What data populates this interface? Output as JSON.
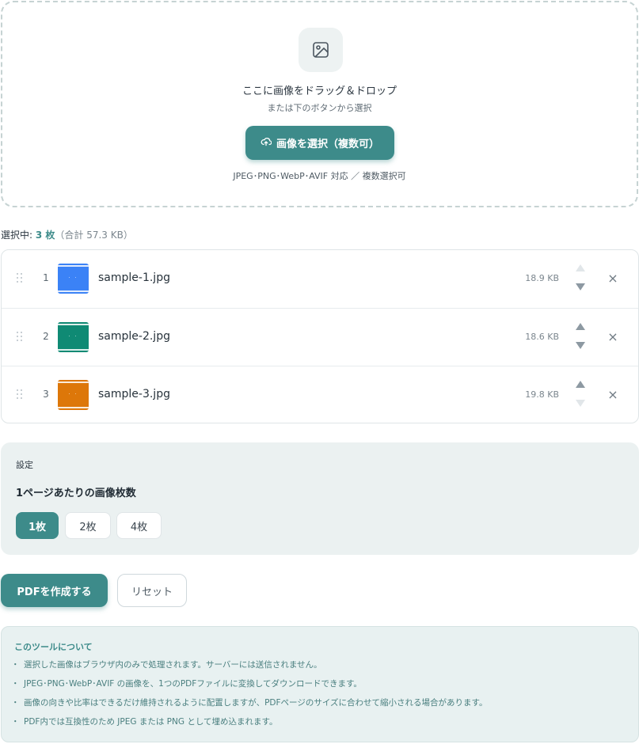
{
  "dropzone": {
    "title": "ここに画像をドラッグ＆ドロップ",
    "subtitle": "または下のボタンから選択",
    "button_label": "画像を選択（複数可）",
    "formats": "JPEG･PNG･WebP･AVIF 対応 ／ 複数選択可",
    "icon": "image-icon",
    "button_icon": "cloud-upload-icon"
  },
  "summary": {
    "prefix": "選択中: ",
    "count": "3 枚",
    "total": "（合計 57.3 KB）"
  },
  "files": [
    {
      "index": "1",
      "name": "sample-1.jpg",
      "size": "18.9 KB",
      "color": "#3b82f6"
    },
    {
      "index": "2",
      "name": "sample-2.jpg",
      "size": "18.6 KB",
      "color": "#0f8a74"
    },
    {
      "index": "3",
      "name": "sample-3.jpg",
      "size": "19.8 KB",
      "color": "#dd7709"
    }
  ],
  "settings": {
    "title": "設定",
    "per_page_label": "1ページあたりの画像枚数",
    "options": [
      "1枚",
      "2枚",
      "4枚"
    ],
    "selected": "1枚"
  },
  "actions": {
    "create_label": "PDFを作成する",
    "reset_label": "リセット"
  },
  "about": {
    "title": "このツールについて",
    "items": [
      "選択した画像はブラウザ内のみで処理されます。サーバーには送信されません。",
      "JPEG･PNG･WebP･AVIF の画像を、1つのPDFファイルに変換してダウンロードできます。",
      "画像の向きや比率はできるだけ維持されるように配置しますが、PDFページのサイズに合わせて縮小される場合があります。",
      "PDF内では互換性のため JPEG または PNG として埋め込まれます。"
    ]
  },
  "colors": {
    "accent": "#3d8b8a",
    "panel": "#ebf1f1"
  }
}
